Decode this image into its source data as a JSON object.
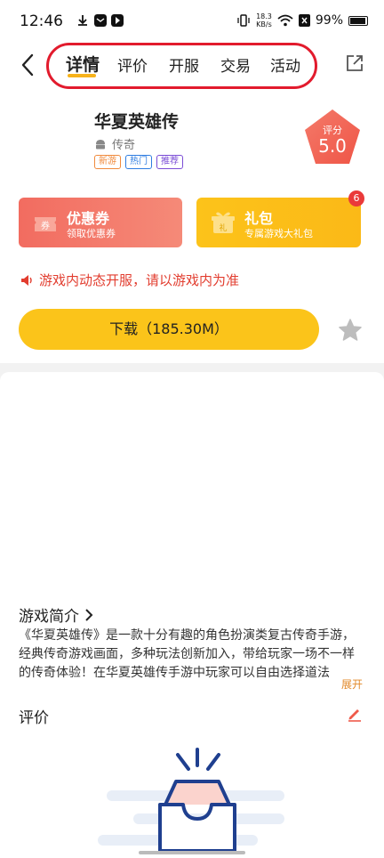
{
  "status": {
    "time": "12:46",
    "net_speed_value": "18.3",
    "net_speed_unit": "KB/s",
    "battery": "99%"
  },
  "nav": {
    "tabs": [
      {
        "label": "详情"
      },
      {
        "label": "评价"
      },
      {
        "label": "开服"
      },
      {
        "label": "交易"
      },
      {
        "label": "活动"
      }
    ],
    "active_tab": "详情",
    "annotation_color": "#e21b2d",
    "accent": "#f7b21a"
  },
  "game": {
    "name": "华夏英雄传",
    "platform_icon": "android-icon",
    "genre": "传奇",
    "tags": [
      "新游",
      "热门",
      "推荐"
    ],
    "score_label": "评分",
    "score_value": "5.0"
  },
  "cards": {
    "coupon": {
      "title": "优惠券",
      "subtitle": "领取优惠券",
      "icon_text": "券"
    },
    "gift": {
      "title": "礼包",
      "subtitle": "专属游戏大礼包",
      "icon_text": "礼",
      "badge": "6"
    }
  },
  "notice": "游戏内动态开服，请以游戏内为准",
  "download": {
    "label": "下载（185.30M）",
    "color": "#fbc41a"
  },
  "intro": {
    "title": "游戏简介",
    "text": "《华夏英雄传》是一款十分有趣的角色扮演类复古传奇手游，经典传奇游戏画面，多种玩法创新加入，带给玩家一场不一样的传奇体验！在华夏英雄传手游中玩家可以自由选择道法",
    "expand": "展开"
  },
  "reviews": {
    "title": "评价"
  }
}
